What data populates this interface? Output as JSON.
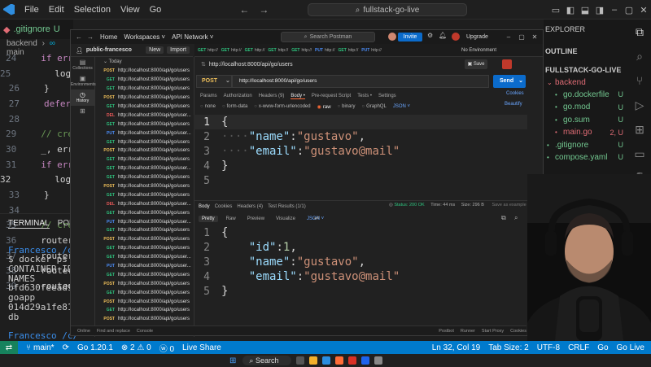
{
  "vscode": {
    "menu": [
      "File",
      "Edit",
      "Selection",
      "View",
      "Go"
    ],
    "command_center": "fullstack-go-live",
    "tab": {
      "name": ".gitignore",
      "status": "U"
    },
    "breadcrumb": [
      "backend",
      "main"
    ],
    "code_lines": [
      {
        "n": "24",
        "text": "if err",
        "kind": "kw"
      },
      {
        "n": "25",
        "text": "log.",
        "kind": "plain",
        "indent": 2
      },
      {
        "n": "26",
        "text": "}",
        "kind": "plain"
      },
      {
        "n": "27",
        "text": "defer",
        "kind": "kw"
      },
      {
        "n": "28",
        "text": "",
        "kind": "plain"
      },
      {
        "n": "29",
        "text": "// cre",
        "kind": "cm"
      },
      {
        "n": "30",
        "text": "_, err",
        "kind": "plain"
      },
      {
        "n": "31",
        "text": "if err",
        "kind": "kw"
      },
      {
        "n": "32",
        "text": "log.",
        "kind": "plain",
        "indent": 2
      },
      {
        "n": "33",
        "text": "}",
        "kind": "plain"
      },
      {
        "n": "34",
        "text": "",
        "kind": "plain"
      },
      {
        "n": "35",
        "text": "// cre",
        "kind": "cm"
      },
      {
        "n": "36",
        "text": "router",
        "kind": "plain"
      },
      {
        "n": "37",
        "text": "router",
        "kind": "plain"
      },
      {
        "n": "38",
        "text": "router",
        "kind": "plain"
      },
      {
        "n": "39",
        "text": "router",
        "kind": "plain"
      }
    ],
    "terminal_tabs": [
      "TERMINAL",
      "PORTS"
    ],
    "terminal_lines": [
      "",
      "Francesco /c/",
      "$ docker ps -",
      "CONTAINER ID",
      " NAMES",
      "bfd630feead9",
      " goapp",
      "014d29a1fe81",
      " db",
      "",
      "Francesco /c/",
      "$"
    ],
    "explorer": {
      "title": "EXPLORER",
      "outline": "OUTLINE",
      "root": "FULLSTACK-GO-LIVE",
      "items": [
        {
          "name": "backend",
          "status": "",
          "color": "#e06c75",
          "indent": 1
        },
        {
          "name": "go.dockerfile",
          "status": "U",
          "color": "#73c991",
          "indent": 2
        },
        {
          "name": "go.mod",
          "status": "U",
          "color": "#73c991",
          "indent": 2
        },
        {
          "name": "go.sum",
          "status": "U",
          "color": "#73c991",
          "indent": 2
        },
        {
          "name": "main.go",
          "status": "2, U",
          "color": "#e06c75",
          "indent": 2
        },
        {
          "name": ".gitignore",
          "status": "U",
          "color": "#73c991",
          "indent": 1
        },
        {
          "name": "compose.yaml",
          "status": "U",
          "color": "#73c991",
          "indent": 1
        }
      ]
    },
    "status_bar": {
      "branch": "main*",
      "go_version": "Go 1.20.1",
      "problems": "⊗ 2 ⚠ 0",
      "ports": "ⓦ 0",
      "live_share": "Live Share",
      "position": "Ln 32, Col 19",
      "tab_size": "Tab Size: 2",
      "encoding": "UTF-8",
      "eol": "CRLF",
      "language": "Go",
      "go_live": "Go Live"
    },
    "taskbar": {
      "search": "Search"
    }
  },
  "postman": {
    "nav": [
      "Home",
      "Workspaces ˅",
      "API Network ˅"
    ],
    "search": "Search Postman",
    "invite": "Invite",
    "upgrade": "Upgrade",
    "workspace": "public-francesco",
    "new_btn": "New",
    "import_btn": "Import",
    "rail": [
      "Collections",
      "Environments",
      "History"
    ],
    "history_today": "Today",
    "history": [
      {
        "m": "POST",
        "u": "http://localhost:8000/api/go/users"
      },
      {
        "m": "GET",
        "u": "http://localhost:8000/api/go/users"
      },
      {
        "m": "GET",
        "u": "http://localhost:8000/api/go/users"
      },
      {
        "m": "POST",
        "u": "http://localhost:8000/api/go/users"
      },
      {
        "m": "GET",
        "u": "http://localhost:8000/api/go/users"
      },
      {
        "m": "DEL",
        "u": "http://localhost:8000/api/go/user..."
      },
      {
        "m": "GET",
        "u": "http://localhost:8000/api/go/users"
      },
      {
        "m": "PUT",
        "u": "http://localhost:8000/api/go/user..."
      },
      {
        "m": "GET",
        "u": "http://localhost:8000/api/go/users"
      },
      {
        "m": "POST",
        "u": "http://localhost:8000/api/go/users"
      },
      {
        "m": "GET",
        "u": "http://localhost:8000/api/go/users"
      },
      {
        "m": "GET",
        "u": "http://localhost:8000/api/go/user..."
      },
      {
        "m": "GET",
        "u": "http://localhost:8000/api/go/users"
      },
      {
        "m": "POST",
        "u": "http://localhost:8000/api/go/users"
      },
      {
        "m": "GET",
        "u": "http://localhost:8000/api/go/users"
      },
      {
        "m": "DEL",
        "u": "http://localhost:8000/api/go/user..."
      },
      {
        "m": "GET",
        "u": "http://localhost:8000/api/go/users"
      },
      {
        "m": "PUT",
        "u": "http://localhost:8000/api/go/user..."
      },
      {
        "m": "GET",
        "u": "http://localhost:8000/api/go/users"
      },
      {
        "m": "POST",
        "u": "http://localhost:8000/api/go/users"
      },
      {
        "m": "GET",
        "u": "http://localhost:8000/api/go/users"
      },
      {
        "m": "GET",
        "u": "http://localhost:8000/api/go/user..."
      },
      {
        "m": "PUT",
        "u": "http://localhost:8000/api/go/user..."
      },
      {
        "m": "GET",
        "u": "http://localhost:8000/api/go/users"
      },
      {
        "m": "POST",
        "u": "http://localhost:8000/api/go/users"
      },
      {
        "m": "GET",
        "u": "http://localhost:8000/api/go/users"
      },
      {
        "m": "POST",
        "u": "http://localhost:8000/api/go/users"
      },
      {
        "m": "GET",
        "u": "http://localhost:8000/api/go/users"
      },
      {
        "m": "POST",
        "u": "http://localhost:8000/api/go/users"
      }
    ],
    "tabs": [
      {
        "m": "GET",
        "u": "http://"
      },
      {
        "m": "GET",
        "u": "http://"
      },
      {
        "m": "GET",
        "u": "http://"
      },
      {
        "m": "GET",
        "u": "http://"
      },
      {
        "m": "GET",
        "u": "http://"
      },
      {
        "m": "PUT",
        "u": "http://"
      },
      {
        "m": "GET",
        "u": "http://"
      },
      {
        "m": "PUT",
        "u": "http://"
      }
    ],
    "environment": "No Environment",
    "request_name": "http://localhost:8000/api/go/users",
    "save": "Save",
    "method": "POST",
    "url": "http://localhost:8000/api/go/users",
    "send": "Send",
    "cookies": "Cookies",
    "beautify": "Beautify",
    "req_tabs": [
      "Params",
      "Authorization",
      "Headers (9)",
      "Body •",
      "Pre-request Script",
      "Tests •",
      "Settings"
    ],
    "body_types": [
      "none",
      "form-data",
      "x-www-form-urlencoded",
      "raw",
      "binary",
      "GraphQL",
      "JSON ˅"
    ],
    "req_body": [
      {
        "n": "1",
        "tokens": [
          {
            "t": "{",
            "c": "p"
          }
        ]
      },
      {
        "n": "2",
        "tokens": [
          {
            "t": "····",
            "c": "d"
          },
          {
            "t": "\"name\"",
            "c": "k"
          },
          {
            "t": ":",
            "c": "p"
          },
          {
            "t": "\"gustavo\"",
            "c": "s"
          },
          {
            "t": ",",
            "c": "p"
          }
        ]
      },
      {
        "n": "3",
        "tokens": [
          {
            "t": "····",
            "c": "d"
          },
          {
            "t": "\"email\"",
            "c": "k"
          },
          {
            "t": ":",
            "c": "p"
          },
          {
            "t": "\"gustavo@mail\"",
            "c": "s"
          }
        ]
      },
      {
        "n": "4",
        "tokens": [
          {
            "t": "}",
            "c": "p"
          }
        ]
      },
      {
        "n": "5",
        "tokens": []
      }
    ],
    "res_tabs": [
      "Body",
      "Cookies",
      "Headers (4)",
      "Test Results (1/1)"
    ],
    "res_status": {
      "status": "Status: 200 OK",
      "time": "Time: 44 ms",
      "size": "Size: 296 B",
      "save": "Save as example"
    },
    "res_view_tabs": [
      "Pretty",
      "Raw",
      "Preview",
      "Visualize",
      "JSON ˅"
    ],
    "res_body": [
      {
        "n": "1",
        "tokens": [
          {
            "t": "{",
            "c": "p"
          }
        ]
      },
      {
        "n": "2",
        "tokens": [
          {
            "t": "    ",
            "c": "p"
          },
          {
            "t": "\"id\"",
            "c": "k"
          },
          {
            "t": ": ",
            "c": "p"
          },
          {
            "t": "1",
            "c": "n"
          },
          {
            "t": ",",
            "c": "p"
          }
        ]
      },
      {
        "n": "3",
        "tokens": [
          {
            "t": "    ",
            "c": "p"
          },
          {
            "t": "\"name\"",
            "c": "k"
          },
          {
            "t": ": ",
            "c": "p"
          },
          {
            "t": "\"gustavo\"",
            "c": "s"
          },
          {
            "t": ",",
            "c": "p"
          }
        ]
      },
      {
        "n": "4",
        "tokens": [
          {
            "t": "    ",
            "c": "p"
          },
          {
            "t": "\"email\"",
            "c": "k"
          },
          {
            "t": ": ",
            "c": "p"
          },
          {
            "t": "\"gustavo@mail\"",
            "c": "s"
          }
        ]
      },
      {
        "n": "5",
        "tokens": [
          {
            "t": "}",
            "c": "p"
          }
        ]
      }
    ],
    "footer_left": [
      "Online",
      "Find and replace",
      "Console"
    ],
    "footer_right": [
      "Postbot",
      "Runner",
      "Start Proxy",
      "Cookies"
    ],
    "method_colors": {
      "GET": "#2ec27e",
      "POST": "#f0c05a",
      "PUT": "#4b8df8",
      "DEL": "#f05b5b"
    }
  }
}
